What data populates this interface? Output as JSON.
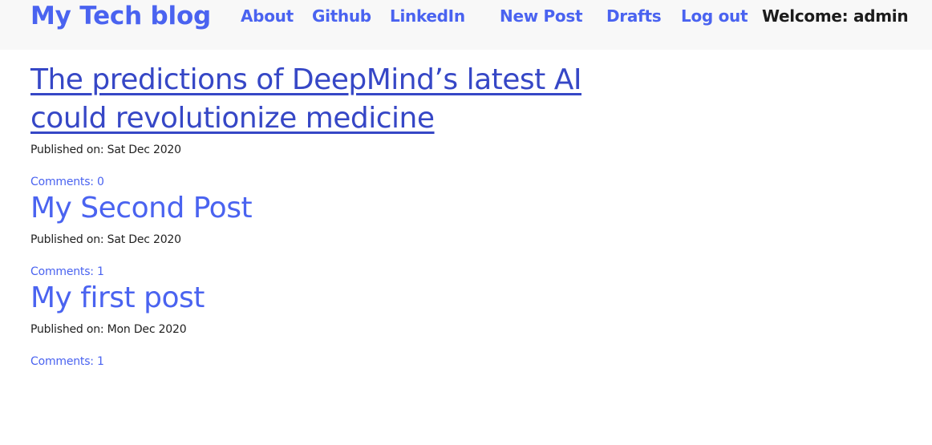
{
  "nav": {
    "brand": "My Tech blog",
    "links": [
      "About",
      "Github",
      "LinkedIn",
      "New Post",
      "Drafts",
      "Log out"
    ],
    "welcome": "Welcome: admin"
  },
  "posts": [
    {
      "title": "The predictions of DeepMind’s latest AI could revolutionize medicine",
      "published": "Published on: Sat Dec 2020",
      "comments": "Comments: 0"
    },
    {
      "title": "My Second Post",
      "published": "Published on: Sat Dec 2020",
      "comments": "Comments: 1"
    },
    {
      "title": "My first post",
      "published": "Published on: Mon Dec 2020",
      "comments": "Comments: 1"
    }
  ],
  "colors": {
    "link": "#4a63f0",
    "visited_link": "#3647c6",
    "navbar_bg": "#f8f8f8",
    "text": "#222222"
  }
}
